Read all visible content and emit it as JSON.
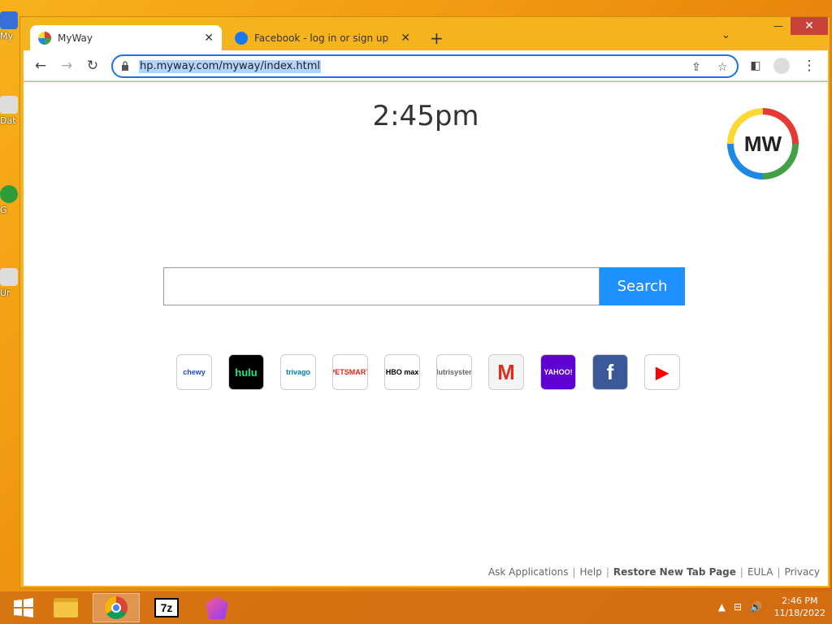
{
  "desktop": {
    "icons": [
      {
        "label": "My"
      },
      {
        "label": "Dat"
      },
      {
        "label": "G"
      },
      {
        "label": "Ur"
      }
    ]
  },
  "browser": {
    "tabs": [
      {
        "title": "MyWay",
        "active": true
      },
      {
        "title": "Facebook - log in or sign up",
        "active": false
      }
    ],
    "new_tab_label": "+",
    "window_controls": {
      "minimize": "—",
      "maximize": "□",
      "close": "✕"
    },
    "address": {
      "url": "hp.myway.com/myway/index.html"
    }
  },
  "page": {
    "clock": "2:45pm",
    "logo_text": "MW",
    "search": {
      "value": "",
      "button_label": "Search"
    },
    "tiles": [
      {
        "name": "chewy",
        "label": "chewy",
        "bg": "#ffffff",
        "fg": "#1c49c2"
      },
      {
        "name": "hulu",
        "label": "hulu",
        "bg": "#000000",
        "fg": "#1ce783"
      },
      {
        "name": "trivago",
        "label": "trivago",
        "bg": "#ffffff",
        "fg": "#007fad"
      },
      {
        "name": "petsmart",
        "label": "PETSMART",
        "bg": "#ffffff",
        "fg": "#e2231a"
      },
      {
        "name": "hbomax",
        "label": "HBO max",
        "bg": "#ffffff",
        "fg": "#000000"
      },
      {
        "name": "nutrisystem",
        "label": "Nutrisystem",
        "bg": "#ffffff",
        "fg": "#666666"
      },
      {
        "name": "gmail",
        "label": "M",
        "bg": "#f4f4f4",
        "fg": "#d93025"
      },
      {
        "name": "yahoo",
        "label": "YAHOO!",
        "bg": "#5f01d1",
        "fg": "#ffffff"
      },
      {
        "name": "facebook",
        "label": "f",
        "bg": "#3b5998",
        "fg": "#ffffff"
      },
      {
        "name": "youtube",
        "label": "▶",
        "bg": "#ffffff",
        "fg": "#ff0000"
      }
    ],
    "footer": [
      {
        "label": "Ask Applications",
        "bold": false
      },
      {
        "label": "Help",
        "bold": false
      },
      {
        "label": "Restore New Tab Page",
        "bold": true
      },
      {
        "label": "EULA",
        "bold": false
      },
      {
        "label": "Privacy",
        "bold": false
      }
    ]
  },
  "taskbar": {
    "time": "2:46 PM",
    "date": "11/18/2022",
    "apps": [
      "start",
      "file-explorer",
      "chrome",
      "7zip",
      "app"
    ]
  },
  "colors": {
    "accent": "#1e90ff",
    "window_frame": "#f5b41d"
  }
}
